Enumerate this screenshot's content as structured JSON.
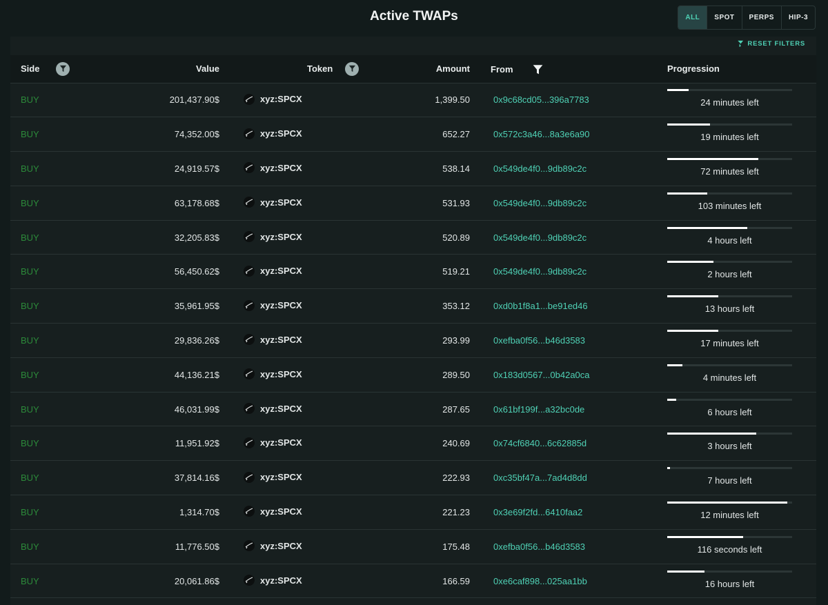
{
  "title": "Active TWAPs",
  "filters": [
    "ALL",
    "SPOT",
    "PERPS",
    "HIP-3"
  ],
  "active_filter": "ALL",
  "reset_label": "RESET FILTERS",
  "columns": {
    "side": "Side",
    "value": "Value",
    "token": "Token",
    "amount": "Amount",
    "from": "From",
    "progression": "Progression"
  },
  "colors": {
    "accent": "#4fd1b5",
    "buy": "#2c8a3a",
    "background": "#121b1b"
  },
  "rows": [
    {
      "side": "BUY",
      "value": "201,437.90$",
      "token": "xyz:SPCX",
      "amount": "1,399.50",
      "from": "0x9c68cd05...396a7783",
      "progress": 0.17,
      "time_left": "24 minutes left"
    },
    {
      "side": "BUY",
      "value": "74,352.00$",
      "token": "xyz:SPCX",
      "amount": "652.27",
      "from": "0x572c3a46...8a3e6a90",
      "progress": 0.34,
      "time_left": "19 minutes left"
    },
    {
      "side": "BUY",
      "value": "24,919.57$",
      "token": "xyz:SPCX",
      "amount": "538.14",
      "from": "0x549de4f0...9db89c2c",
      "progress": 0.73,
      "time_left": "72 minutes left"
    },
    {
      "side": "BUY",
      "value": "63,178.68$",
      "token": "xyz:SPCX",
      "amount": "531.93",
      "from": "0x549de4f0...9db89c2c",
      "progress": 0.32,
      "time_left": "103 minutes left"
    },
    {
      "side": "BUY",
      "value": "32,205.83$",
      "token": "xyz:SPCX",
      "amount": "520.89",
      "from": "0x549de4f0...9db89c2c",
      "progress": 0.64,
      "time_left": "4 hours left"
    },
    {
      "side": "BUY",
      "value": "56,450.62$",
      "token": "xyz:SPCX",
      "amount": "519.21",
      "from": "0x549de4f0...9db89c2c",
      "progress": 0.37,
      "time_left": "2 hours left"
    },
    {
      "side": "BUY",
      "value": "35,961.95$",
      "token": "xyz:SPCX",
      "amount": "353.12",
      "from": "0xd0b1f8a1...be91ed46",
      "progress": 0.41,
      "time_left": "13 hours left"
    },
    {
      "side": "BUY",
      "value": "29,836.26$",
      "token": "xyz:SPCX",
      "amount": "293.99",
      "from": "0xefba0f56...b46d3583",
      "progress": 0.41,
      "time_left": "17 minutes left"
    },
    {
      "side": "BUY",
      "value": "44,136.21$",
      "token": "xyz:SPCX",
      "amount": "289.50",
      "from": "0x183d0567...0b42a0ca",
      "progress": 0.12,
      "time_left": "4 minutes left"
    },
    {
      "side": "BUY",
      "value": "46,031.99$",
      "token": "xyz:SPCX",
      "amount": "287.65",
      "from": "0x61bf199f...a32bc0de",
      "progress": 0.07,
      "time_left": "6 hours left"
    },
    {
      "side": "BUY",
      "value": "11,951.92$",
      "token": "xyz:SPCX",
      "amount": "240.69",
      "from": "0x74cf6840...6c62885d",
      "progress": 0.71,
      "time_left": "3 hours left"
    },
    {
      "side": "BUY",
      "value": "37,814.16$",
      "token": "xyz:SPCX",
      "amount": "222.93",
      "from": "0xc35bf47a...7ad4d8dd",
      "progress": 0.02,
      "time_left": "7 hours left"
    },
    {
      "side": "BUY",
      "value": "1,314.70$",
      "token": "xyz:SPCX",
      "amount": "221.23",
      "from": "0x3e69f2fd...6410faa2",
      "progress": 0.96,
      "time_left": "12 minutes left"
    },
    {
      "side": "BUY",
      "value": "11,776.50$",
      "token": "xyz:SPCX",
      "amount": "175.48",
      "from": "0xefba0f56...b46d3583",
      "progress": 0.61,
      "time_left": "116 seconds left"
    },
    {
      "side": "BUY",
      "value": "20,061.86$",
      "token": "xyz:SPCX",
      "amount": "166.59",
      "from": "0xe6caf898...025aa1bb",
      "progress": 0.3,
      "time_left": "16 hours left"
    }
  ]
}
